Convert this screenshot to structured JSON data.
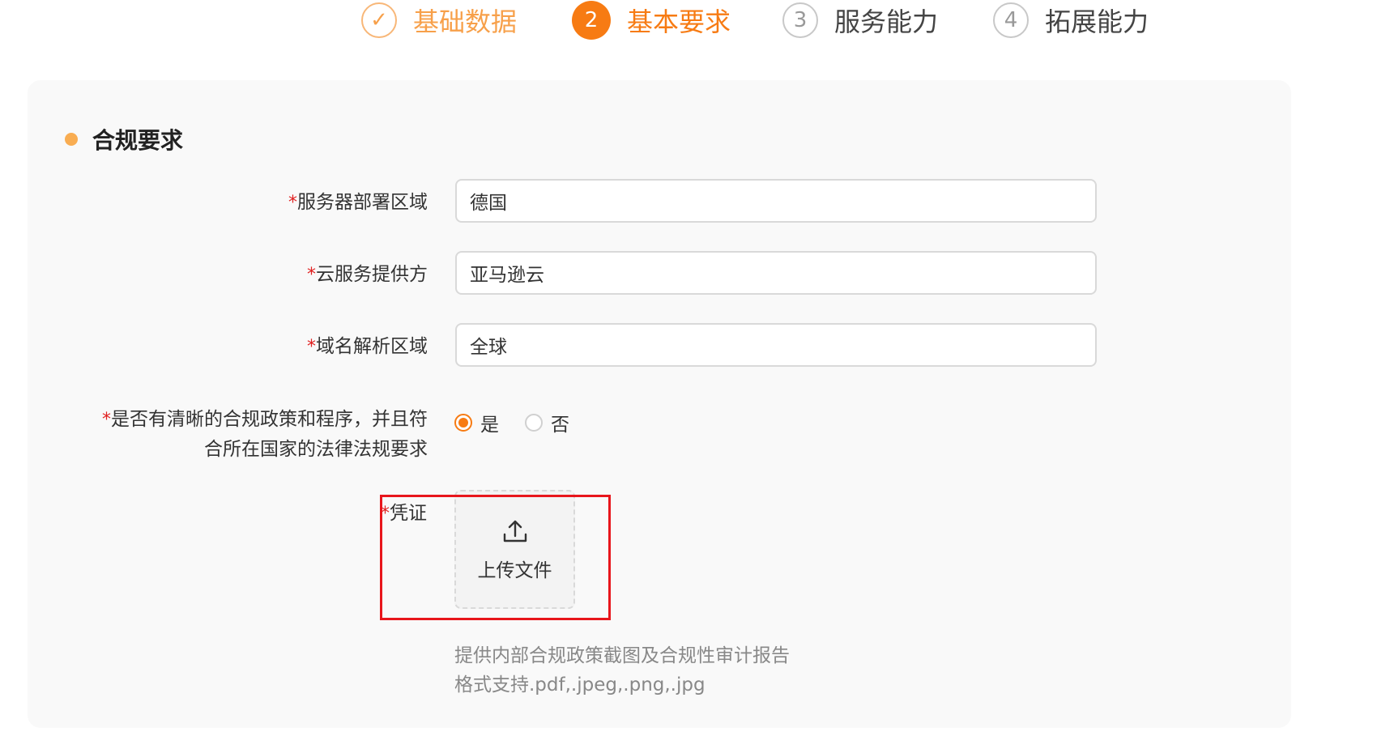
{
  "steps": [
    {
      "index": "✓",
      "label": "基础数据",
      "state": "done"
    },
    {
      "index": "2",
      "label": "基本要求",
      "state": "active"
    },
    {
      "index": "3",
      "label": "服务能力",
      "state": "pending"
    },
    {
      "index": "4",
      "label": "拓展能力",
      "state": "pending"
    }
  ],
  "section": {
    "title": "合规要求"
  },
  "form": {
    "required_mark": "*",
    "server_region": {
      "label": "服务器部署区域",
      "value": "德国"
    },
    "cloud_provider": {
      "label": "云服务提供方",
      "value": "亚马逊云"
    },
    "dns_region": {
      "label": "域名解析区域",
      "value": "全球"
    },
    "compliance_policy": {
      "label_line1": "是否有清晰的合规政策和程序，并且符",
      "label_line2": "合所在国家的法律法规要求",
      "options": [
        {
          "label": "是",
          "checked": true
        },
        {
          "label": "否",
          "checked": false
        }
      ]
    },
    "certificate": {
      "label": "凭证",
      "upload_label": "上传文件",
      "upload_icon": "upload-icon",
      "hint_line1": "提供内部合规政策截图及合规性审计报告",
      "hint_line2": "格式支持.pdf,.jpeg,.png,.jpg"
    }
  },
  "colors": {
    "accent": "#f77b13",
    "done": "#f7a04a",
    "required": "#e02020",
    "highlight_box": "#e8161c"
  }
}
